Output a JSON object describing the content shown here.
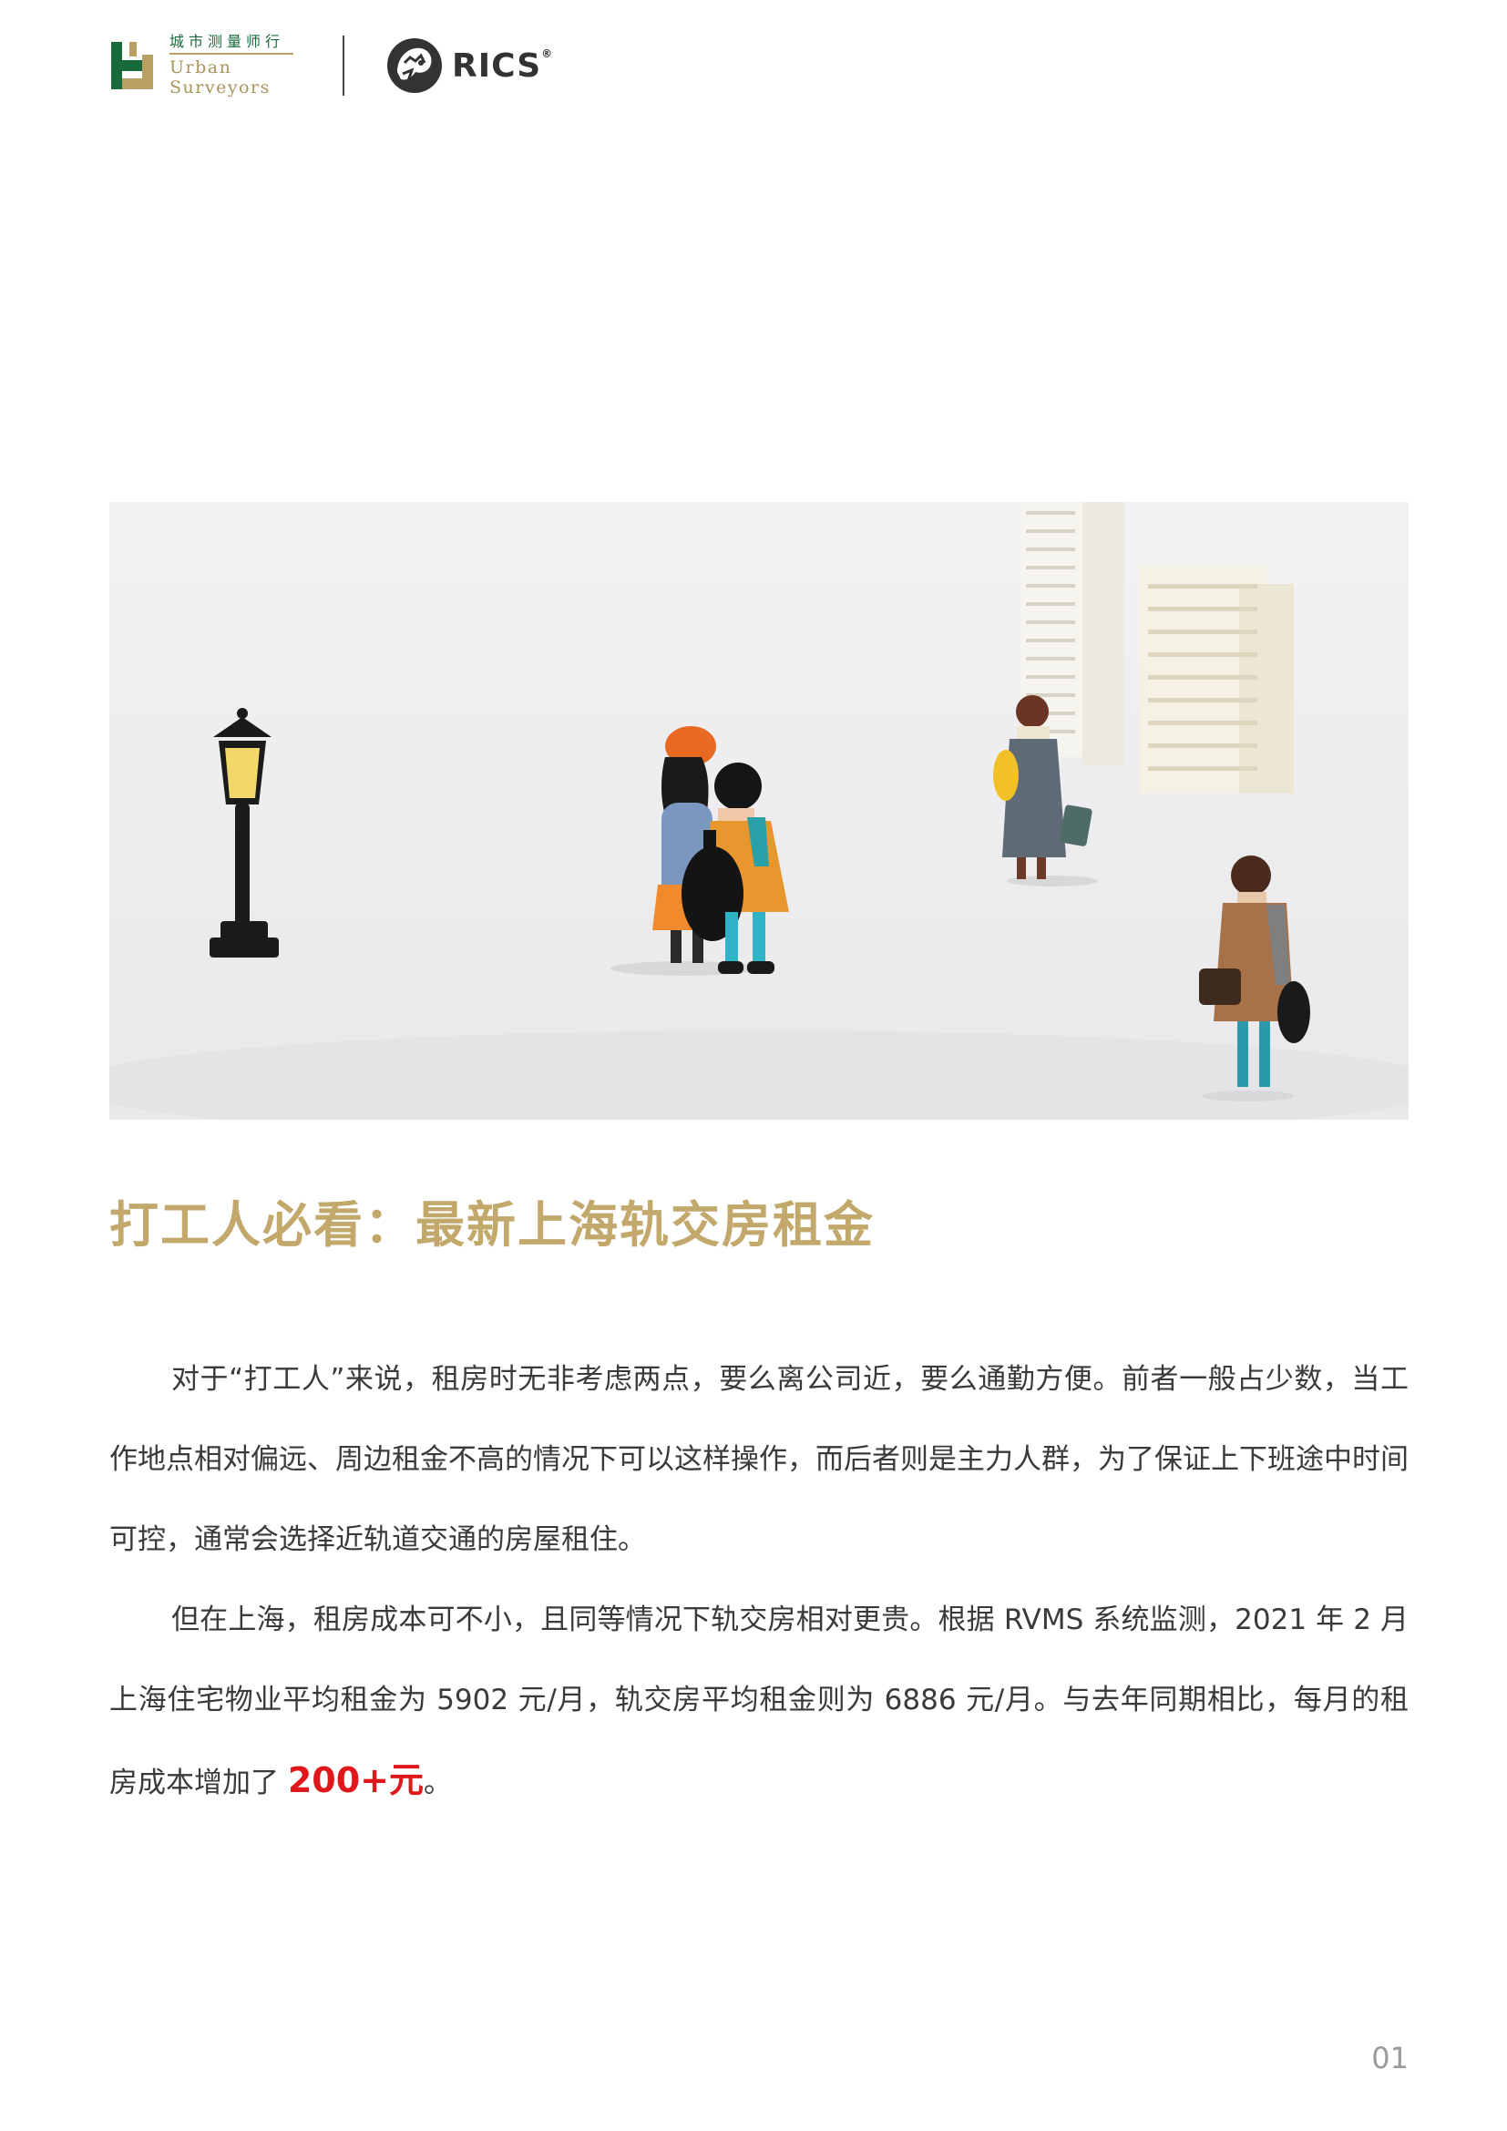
{
  "header": {
    "org_cn": "城市测量师行",
    "org_en_line1": "Urban",
    "org_en_line2": "Surveyors",
    "partner_name": "RICS",
    "partner_mark": "®"
  },
  "hero_image": {
    "alt": ""
  },
  "article": {
    "title": "打工人必看：最新上海轨交房租金",
    "paragraph1": "对于“打工人”来说，租房时无非考虑两点，要么离公司近，要么通勤方便。前者一般占少数，当工作地点相对偏远、周边租金不高的情况下可以这样操作，而后者则是主力人群，为了保证上下班途中时间可控，通常会选择近轨道交通的房屋租住。",
    "paragraph2_main": "但在上海，租房成本可不小，且同等情况下轨交房相对更贵。根据 RVMS 系统监测，2021 年 2 月上海住宅物业平均租金为 5902 元/月，轨交房平均租金则为 6886 元/月。与去年同期相比，每月的租房成本增加了 ",
    "paragraph2_highlight": "200+元",
    "paragraph2_end": "。"
  },
  "footer": {
    "page_number": "01"
  },
  "colors": {
    "title_gold": "#c2a86b",
    "brand_green": "#1a6b3c",
    "brand_gold": "#a8945c",
    "highlight_red": "#e0181b"
  }
}
